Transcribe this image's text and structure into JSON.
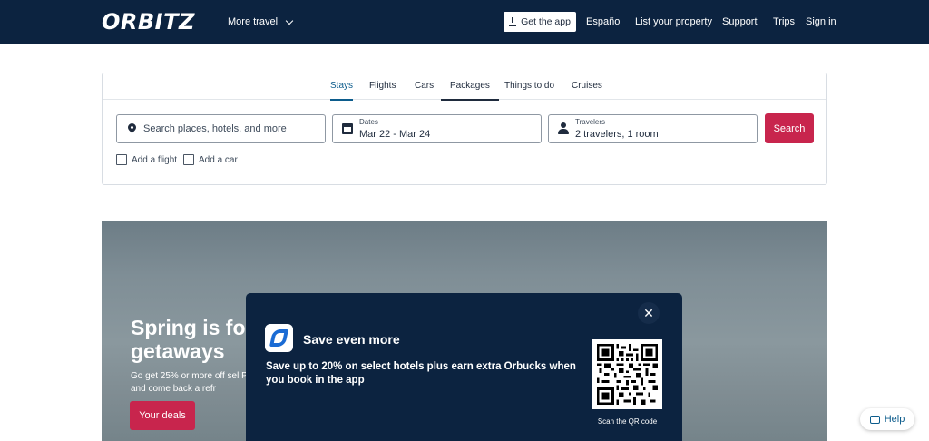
{
  "header": {
    "logo": "ORBITZ",
    "more_travel": "More travel",
    "get_app": "Get the app",
    "links": [
      "Español",
      "List your property",
      "Support",
      "Trips",
      "Sign in"
    ]
  },
  "search": {
    "tabs": [
      "Stays",
      "Flights",
      "Cars",
      "Packages",
      "Things to do",
      "Cruises"
    ],
    "active_tab": "Stays",
    "destination_placeholder": "Search places, hotels, and more",
    "dates_label": "Dates",
    "dates_value": "Mar 22 - Mar 24",
    "travelers_label": "Travelers",
    "travelers_value": "2 travelers, 1 room",
    "search_button": "Search",
    "add_flight": "Add a flight",
    "add_car": "Add a car"
  },
  "hero": {
    "title": "Spring is fo getaways",
    "text": "Go get 25% or more off sel Prices and come back a refr",
    "button": "Your deals"
  },
  "modal": {
    "title": "Save even more",
    "text": "Save up to 20% on select hotels plus earn extra Orbucks when you book in the app",
    "qr_caption": "Scan the QR code",
    "close": "✕"
  },
  "help": "Help",
  "colors": {
    "header_bg": "#0c2340",
    "accent": "#c8254d",
    "active_tab": "#0c5c8c"
  }
}
